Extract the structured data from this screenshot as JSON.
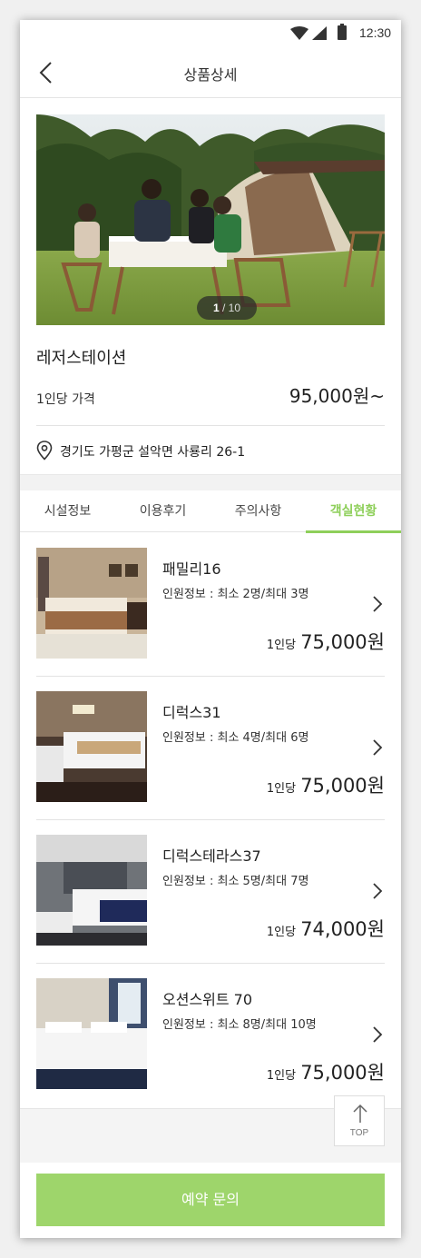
{
  "status_bar": {
    "time": "12:30"
  },
  "header": {
    "title": "상품상세"
  },
  "gallery": {
    "current": "1",
    "separator": "/",
    "total": "10"
  },
  "product": {
    "name": "레저스테이션",
    "price_label": "1인당 가격",
    "price": "95,000원~",
    "address": "경기도 가평군 설악면 사룡리 26-1"
  },
  "tabs": [
    {
      "label": "시설정보"
    },
    {
      "label": "이용후기"
    },
    {
      "label": "주의사항"
    },
    {
      "label": "객실현황",
      "active": true
    }
  ],
  "rooms": [
    {
      "name": "패밀리16",
      "capacity": "인원정보 : 최소 2명/최대 3명",
      "per": "1인당",
      "price": "75,000원"
    },
    {
      "name": "디럭스31",
      "capacity": "인원정보 : 최소 4명/최대 6명",
      "per": "1인당",
      "price": "75,000원"
    },
    {
      "name": "디럭스테라스37",
      "capacity": "인원정보 : 최소 5명/최대 7명",
      "per": "1인당",
      "price": "74,000원"
    },
    {
      "name": "오션스위트 70",
      "capacity": "인원정보 : 최소 8명/최대 10명",
      "per": "1인당",
      "price": "75,000원"
    }
  ],
  "top_button": {
    "label": "TOP"
  },
  "cta": {
    "label": "예약 문의"
  },
  "colors": {
    "accent": "#8ecf5a",
    "cta_bg": "#9ed56b"
  }
}
